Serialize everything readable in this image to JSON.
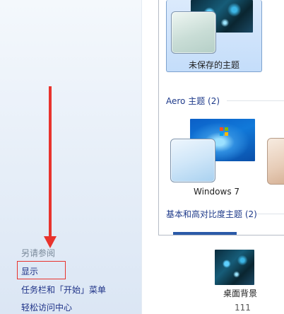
{
  "left_pane": {
    "see_also_title": "另请参阅",
    "links": [
      {
        "label": "显示"
      },
      {
        "label": "任务栏和「开始」菜单"
      },
      {
        "label": "轻松访问中心"
      }
    ],
    "annotation_color": "#e8332d"
  },
  "themes": {
    "selected_tile": {
      "label": "未保存的主题"
    },
    "groups": [
      {
        "header": "Aero 主题 (2)",
        "tiles": [
          {
            "label": "Windows 7"
          }
        ]
      },
      {
        "header": "基本和高对比度主题 (2)"
      }
    ]
  },
  "bottom_bar": {
    "desktop_background_label": "桌面背景",
    "desktop_background_sub": "111"
  },
  "colors": {
    "selection_fill": "#c4ddfa",
    "selection_border": "#7da2ce",
    "link": "#1e3287",
    "group_header": "#1e3a8a"
  },
  "icons": [
    "windows-flag-icon",
    "down-arrow-annotation"
  ]
}
